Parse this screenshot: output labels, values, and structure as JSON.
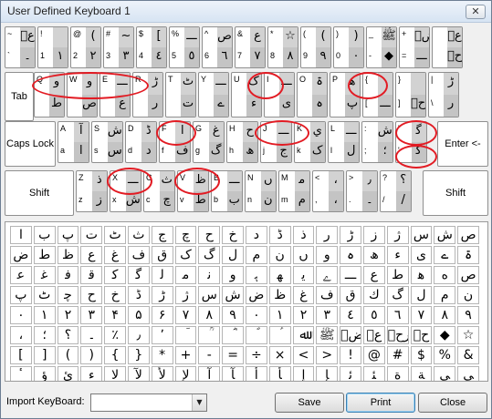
{
  "window": {
    "title": "User Defined Keyboard 1",
    "close_label": "✕"
  },
  "keyboard": {
    "row1": [
      {
        "tl": "~",
        "tr": "عؔ",
        "bl": "`",
        "br": "۔"
      },
      {
        "tl": "!",
        "tr": "",
        "bl": "1",
        "br": "١"
      },
      {
        "tl": "@",
        "tr": "(",
        "bl": "2",
        "br": "٢"
      },
      {
        "tl": "#",
        "tr": "~",
        "bl": "3",
        "br": "٣"
      },
      {
        "tl": "$",
        "tr": "[",
        "bl": "4",
        "br": "٤"
      },
      {
        "tl": "%",
        "tr": "ـــ",
        "bl": "5",
        "br": "٥"
      },
      {
        "tl": "^",
        "tr": "ص",
        "bl": "6",
        "br": "٦"
      },
      {
        "tl": "&",
        "tr": "ع",
        "bl": "7",
        "br": "٧"
      },
      {
        "tl": "*",
        "tr": "☆",
        "bl": "8",
        "br": "٨"
      },
      {
        "tl": "(",
        "tr": "(",
        "bl": "9",
        "br": "٩"
      },
      {
        "tl": ")",
        "tr": ")",
        "bl": "0",
        "br": "٠"
      },
      {
        "tl": "_",
        "tr": "ﷺ",
        "bl": "-",
        "br": "◆"
      },
      {
        "tl": "+",
        "tr": "رضؔ",
        "bl": "=",
        "br": "ـــ"
      },
      {
        "tl": "",
        "tr": "عؒ",
        "bl": "",
        "br": "رحؔ"
      }
    ],
    "row2": [
      {
        "tl": "Q",
        "tr": "ﻭ",
        "bl": "",
        "br": "ط"
      },
      {
        "tl": "W",
        "tr": "و",
        "bl": "",
        "br": "ﺹ"
      },
      {
        "tl": "E",
        "tr": "ـــ",
        "bl": "",
        "br": "ع"
      },
      {
        "tl": "R",
        "tr": "ڑ",
        "bl": "",
        "br": "ر"
      },
      {
        "tl": "T",
        "tr": "ٹ",
        "bl": "",
        "br": "ت"
      },
      {
        "tl": "Y",
        "tr": "ـــ",
        "bl": "",
        "br": "ے"
      },
      {
        "tl": "U",
        "tr": "ک",
        "bl": "",
        "br": "ء"
      },
      {
        "tl": "I",
        "tr": "ـــ",
        "bl": "",
        "br": "ی"
      },
      {
        "tl": "O",
        "tr": "ۃ",
        "bl": "",
        "br": "ہ"
      },
      {
        "tl": "P",
        "tr": "ﻫ",
        "bl": "",
        "br": "پ"
      },
      {
        "tl": "{",
        "tr": "",
        "bl": "[",
        "br": "ـــ"
      },
      {
        "tl": "}",
        "tr": "",
        "bl": "]",
        "br": "حؒ"
      },
      {
        "tl": "|",
        "tr": "ڑ",
        "bl": "\\",
        "br": "ﺭ"
      }
    ],
    "row3": [
      {
        "tl": "A",
        "tr": "آ",
        "bl": "a",
        "br": "ا"
      },
      {
        "tl": "S",
        "tr": "ش",
        "bl": "s",
        "br": "س"
      },
      {
        "tl": "D",
        "tr": "ڈ",
        "bl": "d",
        "br": "د"
      },
      {
        "tl": "F",
        "tr": "ﺍ",
        "bl": "f",
        "br": "ف"
      },
      {
        "tl": "G",
        "tr": "غ",
        "bl": "g",
        "br": "گ"
      },
      {
        "tl": "H",
        "tr": "ح",
        "bl": "h",
        "br": "ھ"
      },
      {
        "tl": "J",
        "tr": "ـــ",
        "bl": "j",
        "br": "ج"
      },
      {
        "tl": "K",
        "tr": "ي",
        "bl": "k",
        "br": "ک"
      },
      {
        "tl": "L",
        "tr": "ـــ",
        "bl": "l",
        "br": "ل"
      },
      {
        "tl": ":",
        "tr": "ﺵ",
        "bl": ";",
        "br": "؛"
      },
      {
        "tl": "\"",
        "tr": "ﮔ",
        "bl": "'",
        "br": "ﮔ"
      }
    ],
    "row4": [
      {
        "tl": "Z",
        "tr": "ذ",
        "bl": "z",
        "br": "ز"
      },
      {
        "tl": "X",
        "tr": "ـــ",
        "bl": "x",
        "br": "ش"
      },
      {
        "tl": "C",
        "tr": "ث",
        "bl": "c",
        "br": "چ"
      },
      {
        "tl": "V",
        "tr": "ظ",
        "bl": "v",
        "br": "ط"
      },
      {
        "tl": "B",
        "tr": "ـــ",
        "bl": "b",
        "br": "ب"
      },
      {
        "tl": "N",
        "tr": "ں",
        "bl": "n",
        "br": "ن"
      },
      {
        "tl": "M",
        "tr": "ﻣ",
        "bl": "m",
        "br": "م"
      },
      {
        "tl": "<",
        "tr": "،",
        "bl": ",",
        "br": "،"
      },
      {
        "tl": ">",
        "tr": "٫",
        "bl": ".",
        "br": "۔"
      },
      {
        "tl": "?",
        "tr": "؟",
        "bl": "/",
        "br": "/"
      }
    ],
    "specials": {
      "tab": "Tab",
      "caps": "Caps Lock",
      "enter": "Enter <-",
      "shift_left": "Shift",
      "shift_right": "Shift"
    }
  },
  "palette": {
    "chars": [
      "ا",
      "ب",
      "پ",
      "ت",
      "ٹ",
      "ث",
      "ج",
      "چ",
      "ح",
      "خ",
      "د",
      "ڈ",
      "ذ",
      "ر",
      "ڑ",
      "ز",
      "ژ",
      "س",
      "ش",
      "ص",
      "ض",
      "ط",
      "ظ",
      "ع",
      "غ",
      "ف",
      "ق",
      "ک",
      "گ",
      "ل",
      "م",
      "ن",
      "ں",
      "و",
      "ہ",
      "ھ",
      "ء",
      "ی",
      "ے",
      "ۃ",
      "ﻋ",
      "ﻏ",
      "ﻓ",
      "ﻗ",
      "ﮐ",
      "ﮔ",
      "ﻟ",
      "ﻣ",
      "ﻧ",
      "ﻭ",
      "ﮨ",
      "ﮭ",
      "ﯾ",
      "ﮮ",
      "ـــ",
      "ﻉ",
      "ﻁ",
      "ﮬ",
      "ﻩ",
      "ﺹ",
      "ﭖ",
      "ﭦ",
      "ﭼ",
      "ﺡ",
      "ﺥ",
      "ﮈ",
      "ﮌ",
      "ﮊ",
      "ﺱ",
      "ﺵ",
      "ﺽ",
      "ﻅ",
      "ﻍ",
      "ﻑ",
      "ﻕ",
      "ﻙ",
      "ﮒ",
      "ﻝ",
      "ﻡ",
      "ﻥ",
      "۰",
      "۱",
      "۲",
      "۳",
      "۴",
      "۵",
      "۶",
      "۷",
      "۸",
      "۹",
      "٠",
      "١",
      "٢",
      "٣",
      "٤",
      "٥",
      "٦",
      "٧",
      "٨",
      "٩",
      "،",
      "؛",
      "؟",
      "۔",
      "٪",
      "٫",
      "٬",
      "ؔ",
      "ؒ",
      "ؓ",
      "ؐ",
      "ؑ",
      "ﷲ",
      "ﷺ",
      "رضؔ",
      "عؒ",
      "رحؔ",
      "حؒ",
      "◆",
      "☆",
      "[",
      "]",
      "(",
      ")",
      "{",
      "}",
      "*",
      "+",
      "-",
      "=",
      "÷",
      "×",
      "<",
      ">",
      "!",
      "@",
      "#",
      "$",
      "%",
      "&",
      "ٴ",
      "ﺅ",
      "ﺉ",
      "ﺀ",
      "ﻻ",
      "ﻵ",
      "ﻷ",
      "ﻹ",
      "ﺁ",
      "ﺂ",
      "ﺃ",
      "ﺄ",
      "ﺇ",
      "ﺈ",
      "ﺋ",
      "ﺌ",
      "ﺓ",
      "ﺔ",
      "ﻰ",
      "ﻲ"
    ]
  },
  "bottom": {
    "import_label": "Import KeyBoard:",
    "import_value": "",
    "save_label": "Save",
    "print_label": "Print",
    "close_label": "Close"
  }
}
